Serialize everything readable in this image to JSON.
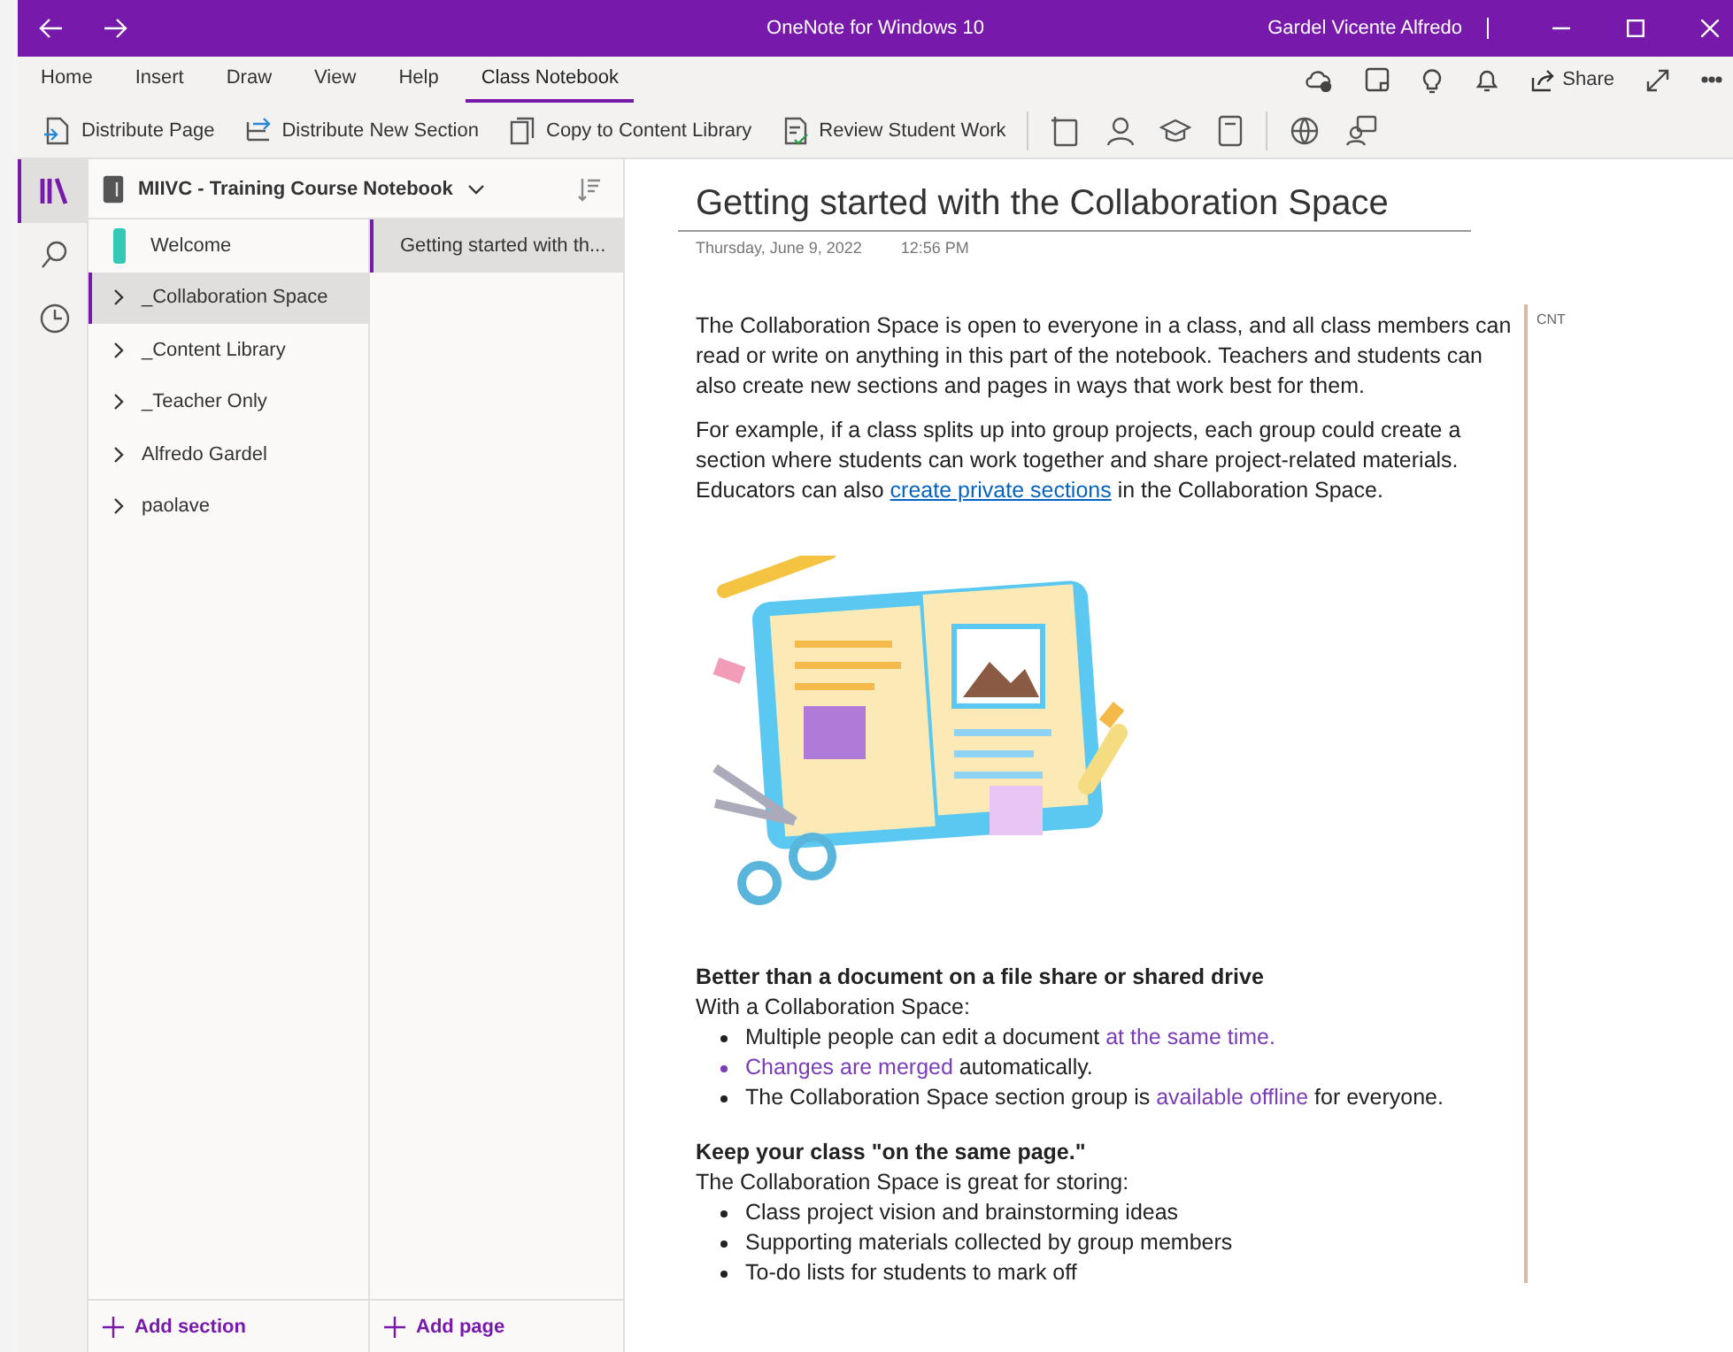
{
  "window": {
    "title": "OneNote for Windows 10",
    "user": "Gardel Vicente Alfredo"
  },
  "ribbon_tabs": [
    {
      "label": "Home",
      "selected": false
    },
    {
      "label": "Insert",
      "selected": false
    },
    {
      "label": "Draw",
      "selected": false
    },
    {
      "label": "View",
      "selected": false
    },
    {
      "label": "Help",
      "selected": false
    },
    {
      "label": "Class Notebook",
      "selected": true
    }
  ],
  "share": {
    "label": "Share"
  },
  "toolbar": [
    {
      "label": "Distribute Page",
      "kind": "page"
    },
    {
      "label": "Distribute New Section",
      "kind": "section"
    },
    {
      "label": "Copy to Content Library",
      "kind": "copy"
    },
    {
      "label": "Review Student Work",
      "kind": "review"
    }
  ],
  "rail": [
    {
      "kind": "library",
      "selected": true
    },
    {
      "kind": "search",
      "selected": false
    },
    {
      "kind": "recent",
      "selected": false
    }
  ],
  "notebook": {
    "name": "MIIVC - Training Course Notebook"
  },
  "sections": [
    {
      "label": "Welcome",
      "kind": "section",
      "color": "#33c9b5",
      "selected": false
    },
    {
      "label": "_Collaboration Space",
      "kind": "group",
      "selected": true
    },
    {
      "label": "_Content Library",
      "kind": "group",
      "selected": false
    },
    {
      "label": "_Teacher Only",
      "kind": "group",
      "selected": false
    },
    {
      "label": "Alfredo Gardel",
      "kind": "group",
      "selected": false
    },
    {
      "label": "paolave",
      "kind": "group",
      "selected": false
    }
  ],
  "pages": [
    {
      "label": "Getting started with th...",
      "selected": true
    }
  ],
  "add_section": "Add section",
  "add_page": "Add page",
  "page": {
    "title": "Getting started with the Collaboration Space",
    "date": "Thursday, June 9, 2022",
    "time": "12:56 PM",
    "tag": "CNT",
    "paragraphs": [
      [
        {
          "text": "The Collaboration Space is open to everyone in a class, and all class members can read or write on anything in this part of the notebook. Teachers and students can also create new sections and pages in ways that work best for them.",
          "kind": "plain"
        }
      ],
      [
        {
          "text": "For example, if a class splits up into group projects, each group could create a section where students can work together and share project-related materials. Educators can also ",
          "kind": "plain"
        },
        {
          "text": "create private sections",
          "kind": "link"
        },
        {
          "text": " in the Collaboration Space.",
          "kind": "plain"
        }
      ]
    ],
    "blocks": [
      {
        "heading": "Better than a document on a file share or shared drive",
        "intro": "With a Collaboration Space:",
        "bullets": [
          [
            {
              "text": "Multiple people can edit a document ",
              "kind": "plain"
            },
            {
              "text": "at the same time.",
              "kind": "accent"
            }
          ],
          [
            {
              "text": "Changes are merged",
              "kind": "accent"
            },
            {
              "text": " automatically.",
              "kind": "plain"
            }
          ],
          [
            {
              "text": "The Collaboration Space section group is ",
              "kind": "plain"
            },
            {
              "text": "available offline",
              "kind": "accent"
            },
            {
              "text": " for everyone.",
              "kind": "plain"
            }
          ]
        ]
      },
      {
        "heading": "Keep your class \"on the same page.\"",
        "intro": "The Collaboration Space is great for storing:",
        "bullets": [
          [
            {
              "text": "Class project vision and brainstorming ideas",
              "kind": "plain"
            }
          ],
          [
            {
              "text": "Supporting materials collected by group members",
              "kind": "plain"
            }
          ],
          [
            {
              "text": "To-do lists for students to mark off",
              "kind": "plain"
            }
          ]
        ]
      }
    ]
  }
}
